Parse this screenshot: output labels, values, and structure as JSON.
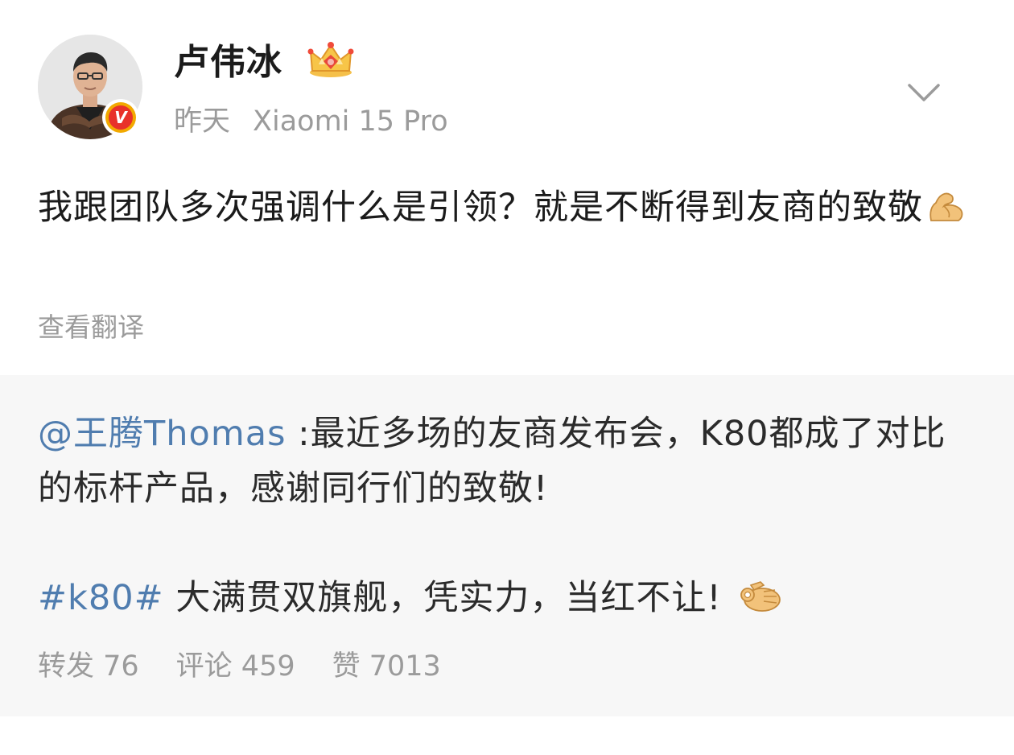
{
  "author": {
    "name": "卢伟冰",
    "verified_badge": "V",
    "crown_icon": "crown-icon"
  },
  "meta": {
    "time": "昨天",
    "device": "Xiaomi 15 Pro"
  },
  "post": {
    "text": "我跟团队多次强调什么是引领？就是不断得到友商的致敬",
    "emoji": "flexed-biceps-icon",
    "translate_label": "查看翻译"
  },
  "repost": {
    "mention": "@王腾Thomas",
    "text": " :最近多场的友商发布会，K80都成了对比的标杆产品，感谢同行们的致敬!",
    "hashtag": "#k80#",
    "text2": " 大满贯双旗舰，凭实力，当红不让! ",
    "emoji": "ok-hand-icon"
  },
  "stats": {
    "repost": "转发 76",
    "comment": "评论 459",
    "like": "赞 7013"
  },
  "colors": {
    "link": "#507daf",
    "secondary_text": "#9b9b9b",
    "primary_text": "#1b1b1b",
    "repost_bg": "#f7f7f7",
    "badge_red": "#e8312a",
    "badge_gold": "#f2a900"
  }
}
